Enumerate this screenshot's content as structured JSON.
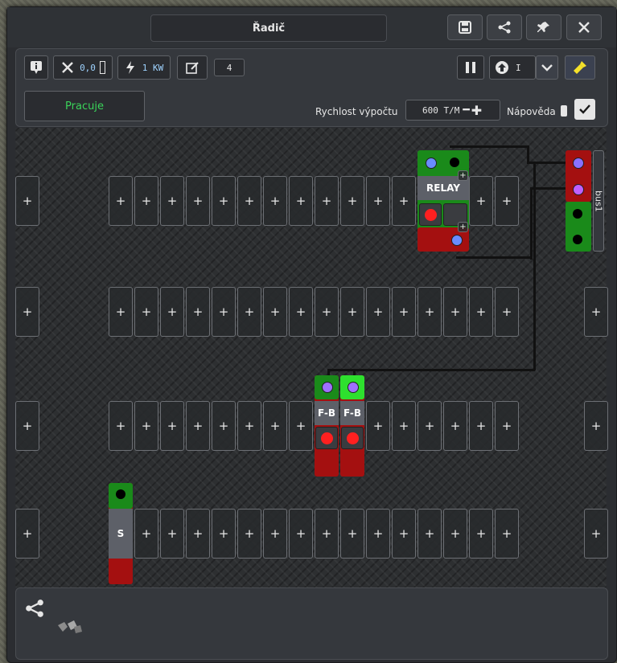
{
  "window": {
    "title": "Řadič"
  },
  "toolbar": {
    "coord_value": "0,0",
    "power_value": "1 KW",
    "edit_count": "4",
    "status_label": "Pracuje",
    "speed_label": "Rychlost výpočtu",
    "speed_value": "600 T/M",
    "help_label": "Nápověda",
    "help_checked": true,
    "direction_value": "I"
  },
  "components": {
    "relay_label": "RELAY",
    "fb1_label": "F-B",
    "fb2_label": "F-B",
    "s_label": "S",
    "bus_label": "bus1",
    "plus": "+"
  },
  "colors": {
    "green": "#1a8a1a",
    "red": "#a41010",
    "bright_green": "#2ee02e",
    "status_text": "#3ad35a"
  }
}
